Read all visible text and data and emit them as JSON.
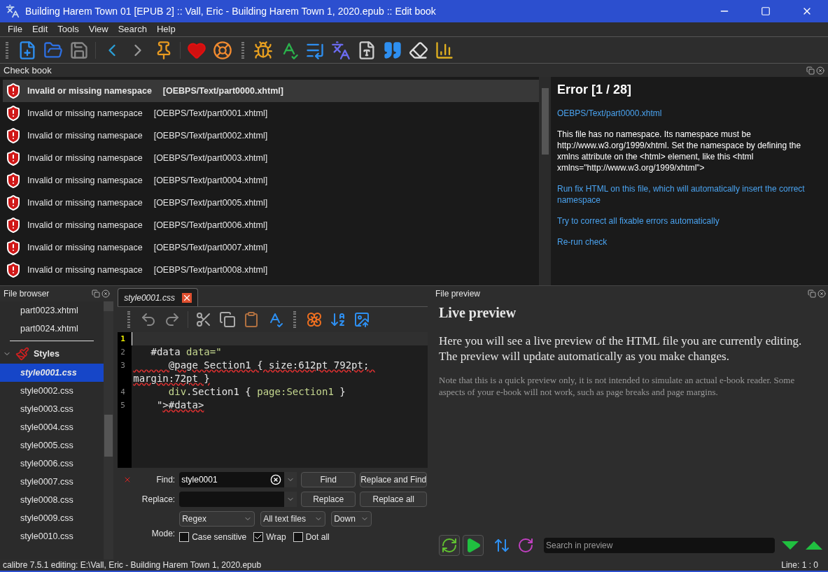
{
  "window": {
    "title": "Building Harem Town 01 [EPUB 2] :: Vall, Eric - Building Harem Town 1, 2020.epub :: Edit book"
  },
  "menu": [
    "File",
    "Edit",
    "Tools",
    "View",
    "Search",
    "Help"
  ],
  "check_book": {
    "title": "Check book",
    "errors": [
      {
        "message": "Invalid or missing namespace",
        "file": "[OEBPS/Text/part0000.xhtml]",
        "selected": true
      },
      {
        "message": "Invalid or missing namespace",
        "file": "[OEBPS/Text/part0001.xhtml]",
        "selected": false
      },
      {
        "message": "Invalid or missing namespace",
        "file": "[OEBPS/Text/part0002.xhtml]",
        "selected": false
      },
      {
        "message": "Invalid or missing namespace",
        "file": "[OEBPS/Text/part0003.xhtml]",
        "selected": false
      },
      {
        "message": "Invalid or missing namespace",
        "file": "[OEBPS/Text/part0004.xhtml]",
        "selected": false
      },
      {
        "message": "Invalid or missing namespace",
        "file": "[OEBPS/Text/part0005.xhtml]",
        "selected": false
      },
      {
        "message": "Invalid or missing namespace",
        "file": "[OEBPS/Text/part0006.xhtml]",
        "selected": false
      },
      {
        "message": "Invalid or missing namespace",
        "file": "[OEBPS/Text/part0007.xhtml]",
        "selected": false
      },
      {
        "message": "Invalid or missing namespace",
        "file": "[OEBPS/Text/part0008.xhtml]",
        "selected": false
      }
    ],
    "detail": {
      "heading": "Error [1 / 28]",
      "file_link": "OEBPS/Text/part0000.xhtml",
      "description": "This file has no namespace. Its namespace must be http://www.w3.org/1999/xhtml. Set the namespace by defining the xmlns attribute on the <html> element, like this <html xmlns=\"http://www.w3.org/1999/xhtml\">",
      "links": [
        "Run fix HTML on this file, which will automatically insert the correct namespace",
        "Try to correct all fixable errors automatically",
        "Re-run check"
      ]
    }
  },
  "file_browser": {
    "title": "File browser",
    "items": [
      {
        "label": "part0023.xhtml",
        "selected": false
      },
      {
        "label": "part0024.xhtml",
        "selected": false
      }
    ],
    "group": {
      "label": "Styles",
      "expanded": true,
      "children": [
        {
          "label": "style0001.css",
          "selected": true
        },
        {
          "label": "style0002.css",
          "selected": false
        },
        {
          "label": "style0003.css",
          "selected": false
        },
        {
          "label": "style0004.css",
          "selected": false
        },
        {
          "label": "style0005.css",
          "selected": false
        },
        {
          "label": "style0006.css",
          "selected": false
        },
        {
          "label": "style0007.css",
          "selected": false
        },
        {
          "label": "style0008.css",
          "selected": false
        },
        {
          "label": "style0009.css",
          "selected": false
        },
        {
          "label": "style0010.css",
          "selected": false
        }
      ]
    }
  },
  "editor": {
    "tab": "style0001.css",
    "lines": [
      {
        "number": "1",
        "current": true
      },
      {
        "number": "2",
        "current": false,
        "segments": [
          {
            "text": "   #data ",
            "kind": "plain"
          },
          {
            "text": "data=\"",
            "kind": "value"
          }
        ]
      },
      {
        "number": "3",
        "current": false,
        "segments": [
          {
            "text": "      @page Section1 { size:612pt 792pt; margin:72pt }",
            "kind": "error"
          }
        ]
      },
      {
        "number": "4",
        "current": false,
        "segments": [
          {
            "text": "      div",
            "kind": "value"
          },
          {
            "text": ".Section1 { ",
            "kind": "plain"
          },
          {
            "text": "page:Section1",
            "kind": "value"
          },
          {
            "text": " }",
            "kind": "plain"
          }
        ]
      },
      {
        "number": "5",
        "current": false,
        "segments": [
          {
            "text": "    \"",
            "kind": "plain"
          },
          {
            "text": ">#data>",
            "kind": "error"
          }
        ]
      }
    ]
  },
  "find": {
    "find_label": "Find:",
    "find_value": "style0001",
    "replace_label": "Replace:",
    "mode_label": "Mode:",
    "buttons": [
      "Find",
      "Replace and Find",
      "Replace",
      "Replace all"
    ],
    "dropdowns": [
      "Regex",
      "All text files",
      "Down"
    ],
    "options": [
      {
        "label": "Case sensitive",
        "checked": false
      },
      {
        "label": "Wrap",
        "checked": true
      },
      {
        "label": "Dot all",
        "checked": false
      }
    ]
  },
  "preview": {
    "title": "File preview",
    "heading": "Live preview",
    "text": "Here you will see a live preview of the HTML file you are currently editing. The preview will update automatically as you make changes.",
    "note": "Note that this is a quick preview only, it is not intended to simulate an actual e-book reader. Some aspects of your e-book will not work, such as page breaks and page margins.",
    "search_placeholder": "Search in preview"
  },
  "status_bar": {
    "left": "calibre 7.5.1 editing: E:\\Vall, Eric - Building Harem Town 1, 2020.epub",
    "right": "Line: 1 : 0"
  }
}
